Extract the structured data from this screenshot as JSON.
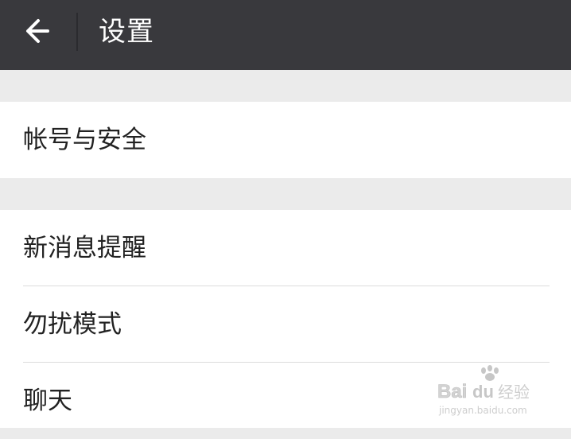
{
  "header": {
    "title": "设置",
    "back_icon": "arrow-left-icon"
  },
  "sections": [
    {
      "items": [
        {
          "label": "帐号与安全"
        }
      ]
    },
    {
      "items": [
        {
          "label": "新消息提醒"
        },
        {
          "label": "勿扰模式"
        },
        {
          "label": "聊天"
        }
      ]
    }
  ],
  "watermark": {
    "brand": "Baidu经验",
    "url": "jingyan.baidu.com"
  },
  "colors": {
    "header_bg": "#39393d",
    "page_bg": "#ebebeb",
    "row_bg": "#ffffff",
    "text": "#222222",
    "divider": "#dcdcdc"
  }
}
